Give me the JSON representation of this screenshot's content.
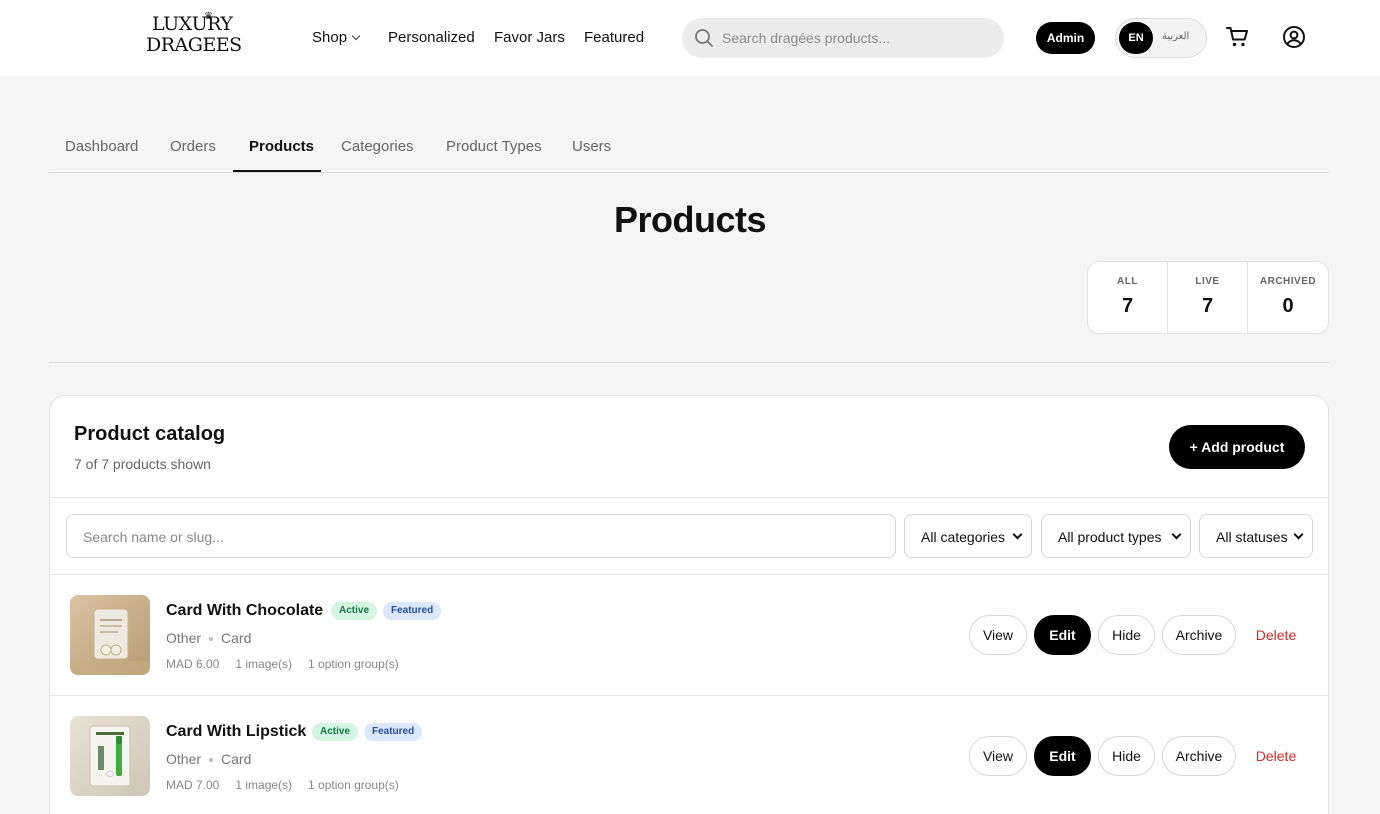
{
  "header": {
    "logo_line1": "LUXURY",
    "logo_line2": "DRAGEES",
    "nav": {
      "shop": "Shop",
      "personalized": "Personalized",
      "favor_jars": "Favor Jars",
      "featured": "Featured"
    },
    "search_placeholder": "Search dragées products...",
    "admin_label": "Admin",
    "lang_en": "EN",
    "lang_ar": "العربية"
  },
  "tabs": {
    "dashboard": "Dashboard",
    "orders": "Orders",
    "products": "Products",
    "categories": "Categories",
    "product_types": "Product Types",
    "users": "Users"
  },
  "page_title": "Products",
  "stats": {
    "all_label": "ALL",
    "all_value": "7",
    "live_label": "LIVE",
    "live_value": "7",
    "archived_label": "ARCHIVED",
    "archived_value": "0"
  },
  "catalog": {
    "title": "Product catalog",
    "subtitle": "7 of 7 products shown",
    "add_button": "+ Add product",
    "search_placeholder": "Search name or slug...",
    "category_filter": "All categories",
    "type_filter": "All product types",
    "status_filter": "All statuses"
  },
  "products": [
    {
      "name": "Card With Chocolate",
      "status": "Active",
      "featured": "Featured",
      "category": "Other",
      "type": "Card",
      "price": "MAD 6.00",
      "images": "1 image(s)",
      "options": "1 option group(s)",
      "actions": {
        "view": "View",
        "edit": "Edit",
        "hide": "Hide",
        "archive": "Archive",
        "delete": "Delete"
      }
    },
    {
      "name": "Card With Lipstick",
      "status": "Active",
      "featured": "Featured",
      "category": "Other",
      "type": "Card",
      "price": "MAD 7.00",
      "images": "1 image(s)",
      "options": "1 option group(s)",
      "actions": {
        "view": "View",
        "edit": "Edit",
        "hide": "Hide",
        "archive": "Archive",
        "delete": "Delete"
      }
    }
  ],
  "colors": {
    "accent": "#000000",
    "active_badge_bg": "#d5f5e3",
    "featured_badge_bg": "#dbe7fb",
    "delete_text": "#d42828",
    "page_bg": "#f5f5f5"
  },
  "icons": [
    "search-icon",
    "cart-icon",
    "user-icon",
    "chevron-down-icon"
  ]
}
